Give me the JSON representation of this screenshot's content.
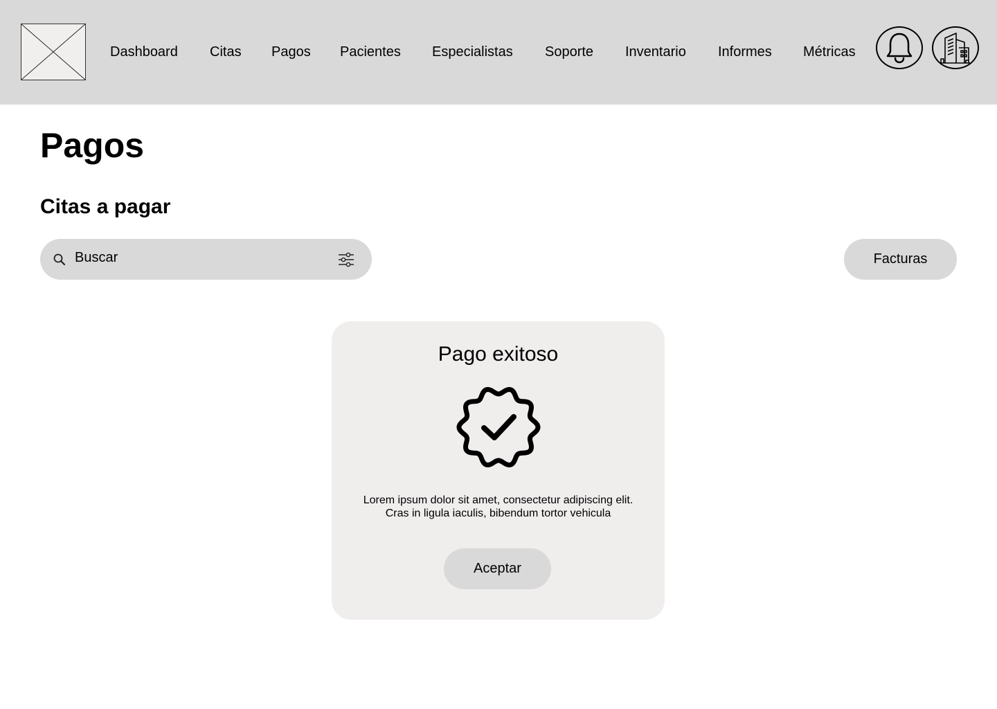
{
  "header": {
    "logo_icon": "image-placeholder-icon",
    "nav": [
      {
        "label": "Dashboard"
      },
      {
        "label": "Citas"
      },
      {
        "label": "Pagos"
      },
      {
        "label": "Pacientes"
      },
      {
        "label": "Especialistas"
      },
      {
        "label": "Soporte"
      },
      {
        "label": "Inventario"
      },
      {
        "label": "Informes"
      },
      {
        "label": "Métricas"
      }
    ],
    "notification_icon": "bell-icon",
    "organization_icon": "building-icon"
  },
  "main": {
    "title": "Pagos",
    "section_title": "Citas a pagar",
    "search": {
      "placeholder": "Buscar",
      "search_icon": "search-icon",
      "filter_icon": "sliders-icon"
    },
    "facturas_label": "Facturas"
  },
  "modal": {
    "title": "Pago exitoso",
    "icon": "verified-badge-check-icon",
    "message_line1": "Lorem ipsum dolor sit amet, consectetur adipiscing elit.",
    "message_line2": "Cras in ligula iaculis, bibendum tortor vehicula",
    "accept_label": "Aceptar"
  },
  "colors": {
    "topbar_bg": "#d9d9d9",
    "modal_bg": "#f0eded",
    "button_bg": "#d9d9d9",
    "text": "#000000"
  }
}
